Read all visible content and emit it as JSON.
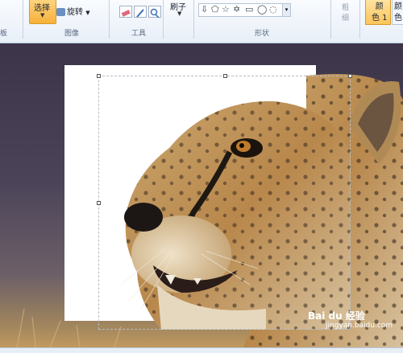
{
  "ribbon": {
    "clipboard_label": "板",
    "select_label": "选择",
    "rotate_label": "旋转",
    "image_group_label": "图像",
    "tools_group_label": "工具",
    "brush_label": "刷子",
    "shapes_group_label": "形状",
    "outline_label": "粗\n细",
    "color1_label": "颜\n色 1",
    "color2_label": "颜\n色"
  },
  "watermark": {
    "logo_text": "Bai du 经验",
    "url": "jingyan.baidu.com"
  },
  "colors": {
    "accent": "#f7b13a",
    "ribbon_bg": "#e8eff8",
    "workspace_bg": "#4a4258"
  }
}
